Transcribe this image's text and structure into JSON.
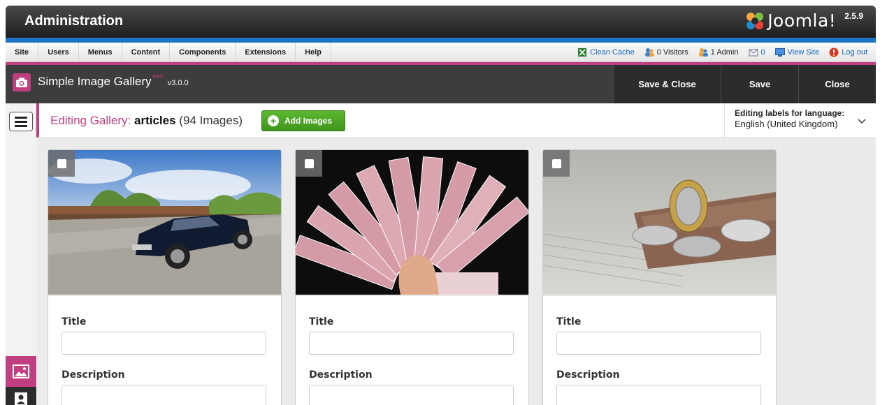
{
  "header": {
    "title": "Administration",
    "brand": "Joomla!",
    "version": "2.5.9",
    "colors": {
      "bar_blue": "#1a74c2",
      "accent_pink": "#c13e81"
    }
  },
  "menu": {
    "items": [
      "Site",
      "Users",
      "Menus",
      "Content",
      "Components",
      "Extensions",
      "Help"
    ]
  },
  "status": {
    "clean_cache": "Clean Cache",
    "visitors": "0 Visitors",
    "admins": "1 Admin",
    "messages": "0",
    "view_site": "View Site",
    "logout": "Log out"
  },
  "component": {
    "title": "Simple Image Gallery",
    "edition": "PRO",
    "version": "v3.0.0",
    "icon": "camera-icon"
  },
  "toolbar": {
    "save_close": "Save & Close",
    "save": "Save",
    "close": "Close"
  },
  "editing": {
    "prefix": "Editing Gallery:",
    "gallery_name": "articles",
    "count": "(94 Images)",
    "add_images": "Add Images"
  },
  "language": {
    "label": "Editing labels for language:",
    "selected": "English (United Kingdom)"
  },
  "cards": [
    {
      "image": "car",
      "title_label": "Title",
      "title_value": "",
      "description_label": "Description",
      "description_value": ""
    },
    {
      "image": "euro-banknotes",
      "title_label": "Title",
      "title_value": "",
      "description_label": "Description",
      "description_value": ""
    },
    {
      "image": "coins-on-newspaper",
      "title_label": "Title",
      "title_value": "",
      "description_label": "Description",
      "description_value": ""
    }
  ]
}
